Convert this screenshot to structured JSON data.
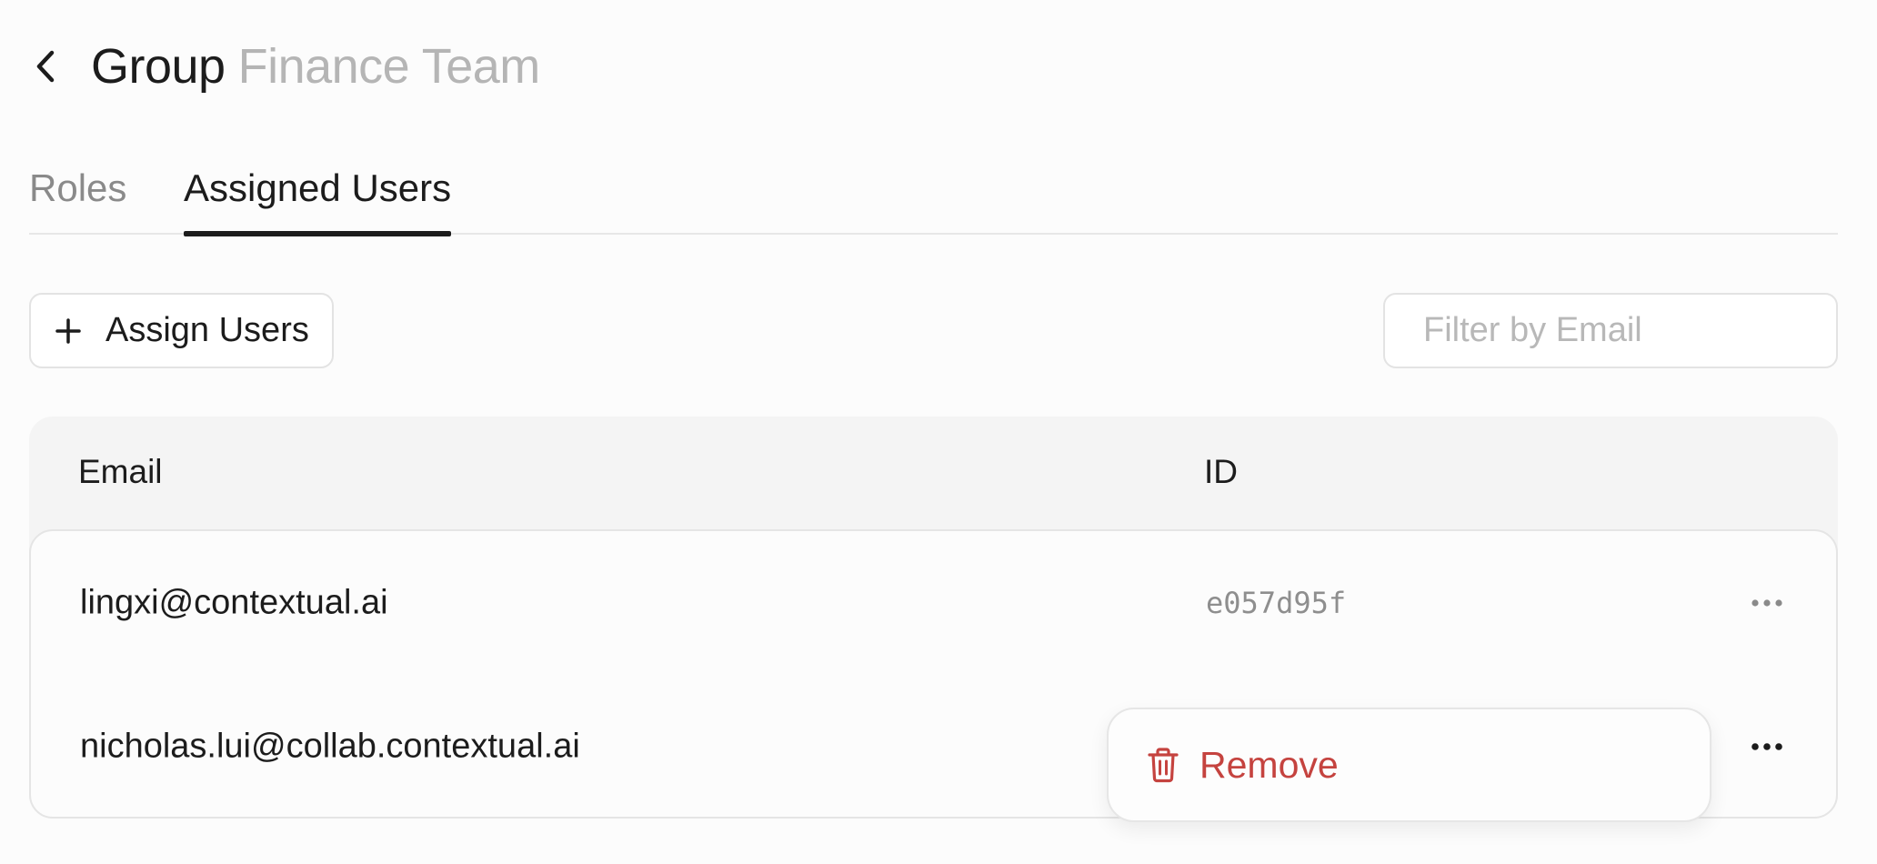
{
  "header": {
    "title": "Group",
    "subtitle": "Finance Team",
    "back_icon": "chevron-left-icon"
  },
  "tabs": [
    {
      "label": "Roles",
      "active": false
    },
    {
      "label": "Assigned Users",
      "active": true
    }
  ],
  "toolbar": {
    "assign_label": "Assign Users",
    "assign_icon": "plus-icon",
    "filter_placeholder": "Filter by Email",
    "filter_value": "",
    "filter_icon": "search-icon"
  },
  "table": {
    "columns": [
      "Email",
      "ID"
    ],
    "rows": [
      {
        "email": "lingxi@contextual.ai",
        "id": "e057d95f"
      },
      {
        "email": "nicholas.lui@collab.contextual.ai",
        "id": ""
      }
    ],
    "row_action_icon": "more-horizontal-icon"
  },
  "context_menu": {
    "items": [
      {
        "label": "Remove",
        "icon": "trash-icon",
        "color": "#c5433f"
      }
    ]
  },
  "colors": {
    "background": "#fcfcfc",
    "text": "#1c1c1c",
    "muted": "#b5b5b5",
    "danger": "#c5433f"
  }
}
